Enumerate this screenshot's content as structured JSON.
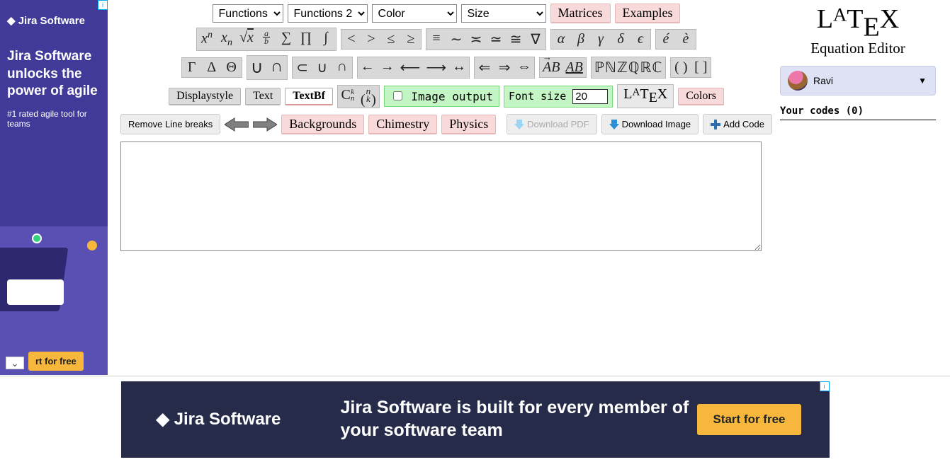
{
  "left_ad": {
    "info_badge": "i",
    "logo": "◆ Jira Software",
    "headline": "Jira Software unlocks the power of agile",
    "sub": "#1 rated agile tool for teams",
    "cta": "rt for free",
    "chevron": "⌄"
  },
  "dropdowns": {
    "functions": "Functions",
    "functions2": "Functions 2",
    "color": "Color",
    "size": "Size"
  },
  "top_buttons": {
    "matrices": "Matrices",
    "examples": "Examples"
  },
  "sym_row1": {
    "g1": [
      "xⁿ",
      "xₙ",
      "√x",
      "a/b",
      "∑",
      "∏",
      "∫"
    ],
    "g2": [
      "<",
      ">",
      "≤",
      "≥"
    ],
    "g3": [
      "≡",
      "∼",
      "≍",
      "≃",
      "≅",
      "∇"
    ],
    "g4": [
      "α",
      "β",
      "γ",
      "δ",
      "ϵ"
    ],
    "g5": [
      "é",
      "è"
    ]
  },
  "sym_row2": {
    "g1": [
      "Γ",
      "Δ",
      "Θ"
    ],
    "g2": [
      "∪",
      "∩"
    ],
    "g3": [
      "⊂",
      "∪",
      "∩"
    ],
    "g4": [
      "←",
      "→",
      "⟵",
      "⟶",
      "↔"
    ],
    "g5": [
      "⇐",
      "⇒",
      "⇔"
    ],
    "g6": [
      "AB⃗",
      "A͟B͟"
    ],
    "g7": [
      "ℙℕℤℚℝℂ"
    ],
    "g8": [
      "( )",
      "[ ]"
    ]
  },
  "toolbar3": {
    "displaystyle": "Displaystyle",
    "text": "Text",
    "textbf": "TextBf",
    "cnk": "Cₙᵏ",
    "binom": "n k",
    "image_output": "Image output",
    "font_size_label": "Font size",
    "font_size_value": "20",
    "latex": "LATEX",
    "colors": "Colors"
  },
  "row4": {
    "remove_breaks": "Remove Line breaks",
    "backgrounds": "Backgrounds",
    "chimestry": "Chimestry",
    "physics": "Physics",
    "download_pdf": "Download PDF",
    "download_image": "Download Image",
    "add_code": "Add Code"
  },
  "textarea_value": "",
  "right": {
    "logo": "LATEX",
    "subtitle": "Equation Editor",
    "user": "Ravi",
    "your_codes": "Your codes (0)"
  },
  "banner": {
    "info_badge": "i",
    "logo": "◆ Jira Software",
    "text": "Jira Software is built for every member of your software team",
    "cta": "Start for free"
  }
}
